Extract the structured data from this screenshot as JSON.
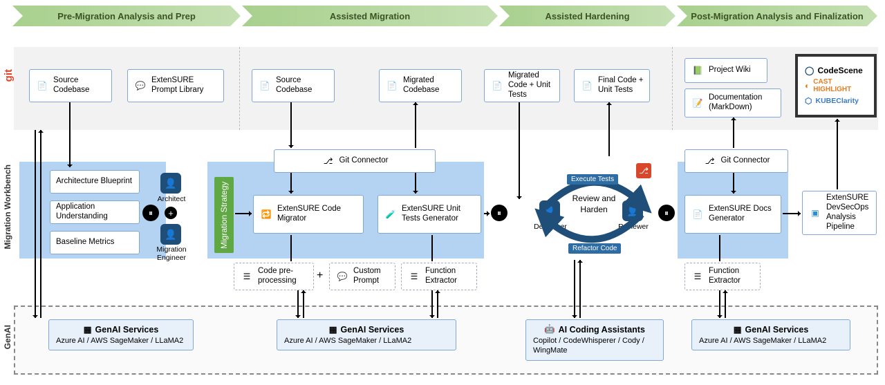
{
  "phases": {
    "p1": "Pre-Migration Analysis and Prep",
    "p2": "Assisted Migration",
    "p3": "Assisted Hardening",
    "p4": "Post-Migration Analysis and Finalization"
  },
  "side": {
    "git": "git",
    "wb": "Migration Workbench",
    "genai": "GenAI"
  },
  "gitRow": {
    "srcCodebase1": "Source Codebase",
    "promptLib": "ExtenSURE Prompt Library",
    "srcCodebase2": "Source Codebase",
    "migratedCodebase": "Migrated Codebase",
    "migratedCodeTests": "Migrated Code + Unit Tests",
    "finalCodeTests": "Final Code + Unit Tests",
    "projectWiki": "Project Wiki",
    "docsMd": "Documentation (MarkDown)"
  },
  "wb": {
    "archBlueprint": "Architecture Blueprint",
    "appUnderstanding": "Application Understanding",
    "baselineMetrics": "Baseline Metrics",
    "architect": "Architect",
    "migEngineer": "Migration Engineer",
    "migStrategy": "Migration Strategy",
    "gitConnector1": "Git Connector",
    "codeMigrator": "ExtenSURE Code Migrator",
    "utGenerator": "ExtenSURE Unit Tests Generator",
    "codePre": "Code pre-processing",
    "customPrompt": "Custom Prompt",
    "funcExtractor1": "Function Extractor",
    "reviewHarden": "Review and Harden",
    "execTests": "Execute Tests",
    "refactor": "Refactor Code",
    "developer": "Developer",
    "reviewer": "Reviewer",
    "gitConnector2": "Git Connector",
    "docsGen": "ExtenSURE Docs Generator",
    "funcExtractor2": "Function Extractor",
    "pipeline": "ExtenSURE DevSecOps Analysis Pipeline"
  },
  "tools": {
    "codescene": "CodeScene",
    "cast": "CAST HIGHLIGHT",
    "kubeclarity": "KUBEClarity"
  },
  "genai": {
    "title": "GenAI Services",
    "subtitle": "Azure AI / AWS SageMaker / LLaMA2",
    "aicoding_title": "AI Coding Assistants",
    "aicoding_sub": "Copilot / CodeWhisperer / Cody / WingMate"
  }
}
